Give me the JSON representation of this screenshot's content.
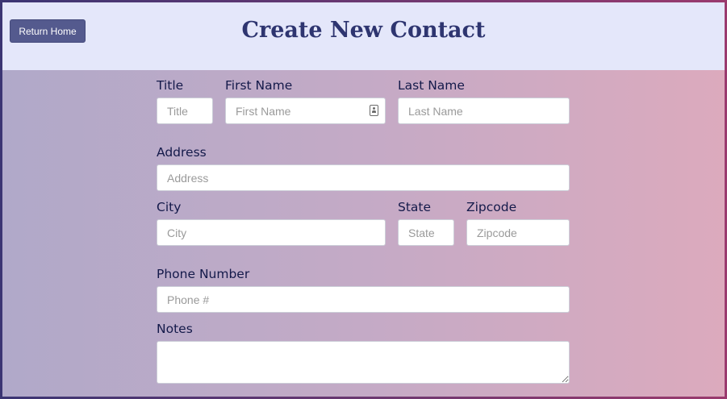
{
  "header": {
    "title": "Create New Contact",
    "return_home_label": "Return Home"
  },
  "form": {
    "title": {
      "label": "Title",
      "placeholder": "Title",
      "value": ""
    },
    "first_name": {
      "label": "First Name",
      "placeholder": "First Name",
      "value": ""
    },
    "last_name": {
      "label": "Last Name",
      "placeholder": "Last Name",
      "value": ""
    },
    "address": {
      "label": "Address",
      "placeholder": "Address",
      "value": ""
    },
    "city": {
      "label": "City",
      "placeholder": "City",
      "value": ""
    },
    "state": {
      "label": "State",
      "placeholder": "State",
      "value": ""
    },
    "zipcode": {
      "label": "Zipcode",
      "placeholder": "Zipcode",
      "value": ""
    },
    "phone": {
      "label": "Phone Number",
      "placeholder": "Phone #",
      "value": ""
    },
    "notes": {
      "label": "Notes",
      "value": ""
    }
  },
  "icons": {
    "first_name_autofill": "contact-card-icon"
  },
  "colors": {
    "header_bg": "#e4e7fa",
    "title_color": "#2e3570",
    "button_bg": "#545a8e",
    "gradient_left": "#b0a9c9",
    "gradient_right": "#dcaabd"
  }
}
